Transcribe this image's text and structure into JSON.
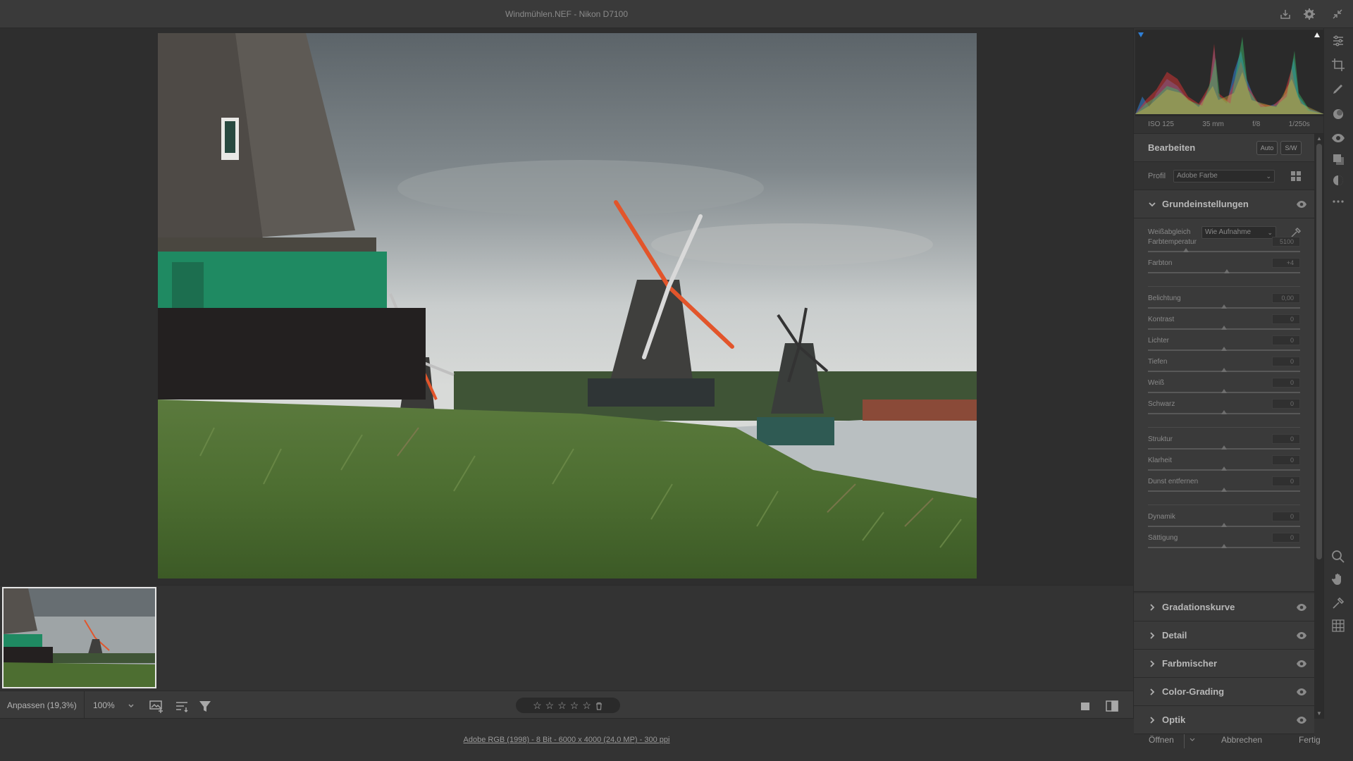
{
  "window": {
    "title": "Windmühlen.NEF - Nikon D7100"
  },
  "titlebar": {
    "icons": [
      "export-icon",
      "gear-icon",
      "collapse-icon"
    ]
  },
  "histogram": {
    "exif": {
      "iso": "ISO 125",
      "focal": "35 mm",
      "aperture": "f/8",
      "shutter": "1/250s"
    }
  },
  "edit": {
    "title": "Bearbeiten",
    "auto_label": "Auto",
    "bw_label": "S/W",
    "profile_label": "Profil",
    "profile_value": "Adobe Farbe"
  },
  "basic": {
    "title": "Grundeinstellungen",
    "wb_label": "Weißabgleich",
    "wb_value": "Wie Aufnahme",
    "sliders": [
      {
        "label": "Farbtemperatur",
        "value": "5100",
        "pos": 0.25
      },
      {
        "label": "Farbton",
        "value": "+4",
        "pos": 0.52
      },
      {
        "label": "Belichtung",
        "value": "0,00",
        "pos": 0.5
      },
      {
        "label": "Kontrast",
        "value": "0",
        "pos": 0.5
      },
      {
        "label": "Lichter",
        "value": "0",
        "pos": 0.5
      },
      {
        "label": "Tiefen",
        "value": "0",
        "pos": 0.5
      },
      {
        "label": "Weiß",
        "value": "0",
        "pos": 0.5
      },
      {
        "label": "Schwarz",
        "value": "0",
        "pos": 0.5
      },
      {
        "label": "Struktur",
        "value": "0",
        "pos": 0.5
      },
      {
        "label": "Klarheit",
        "value": "0",
        "pos": 0.5
      },
      {
        "label": "Dunst entfernen",
        "value": "0",
        "pos": 0.5
      },
      {
        "label": "Dynamik",
        "value": "0",
        "pos": 0.5
      },
      {
        "label": "Sättigung",
        "value": "0",
        "pos": 0.5
      }
    ]
  },
  "sections": [
    {
      "label": "Gradationskurve"
    },
    {
      "label": "Detail"
    },
    {
      "label": "Farbmischer"
    },
    {
      "label": "Color-Grading"
    },
    {
      "label": "Optik"
    }
  ],
  "toolbar": {
    "zoom_fit": "Anpassen (19,3%)",
    "zoom_pct": "100%"
  },
  "status": {
    "workflow_link": "Adobe RGB (1998) - 8 Bit - 6000 x 4000 (24,0 MP) - 300 ppi",
    "open_label": "Öffnen",
    "cancel_label": "Abbrechen",
    "done_label": "Fertig"
  },
  "colors": {
    "panel_bg": "#3a3a3a",
    "accent_blue": "#2f7fd6",
    "windmill_green": "#1f8a62",
    "sail_orange": "#e2552b"
  }
}
